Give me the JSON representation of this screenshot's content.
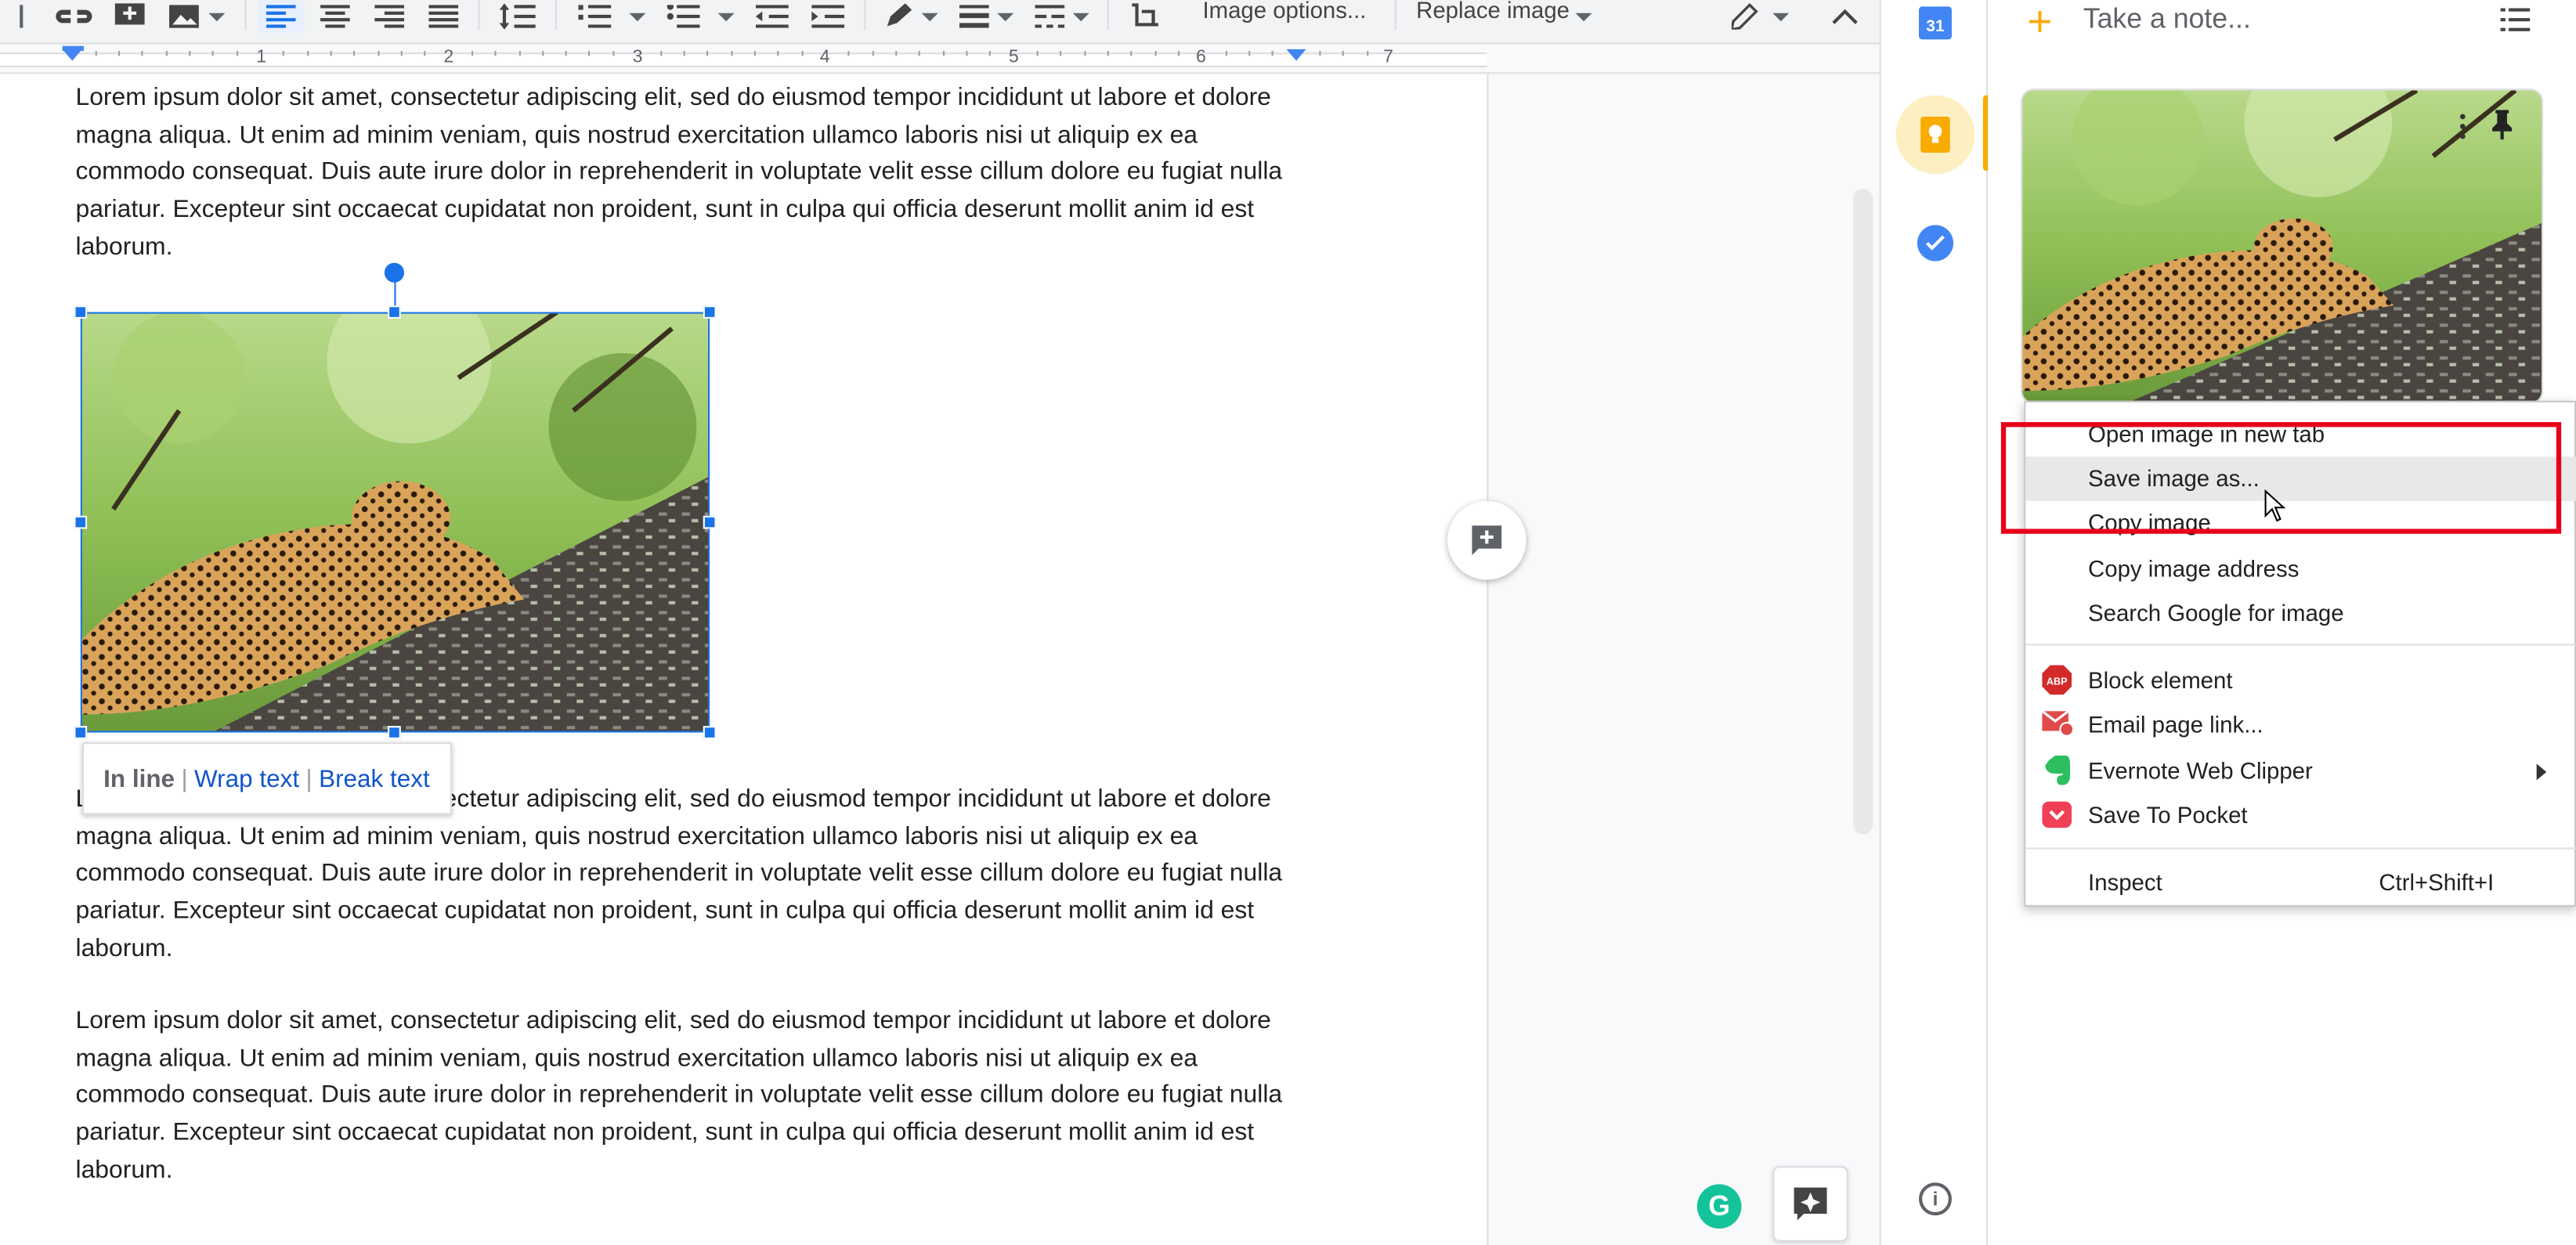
{
  "toolbar": {
    "image_options": "Image options...",
    "replace_image": "Replace image"
  },
  "ruler": {
    "numbers": [
      "1",
      "2",
      "3",
      "4",
      "5",
      "6",
      "7"
    ]
  },
  "document": {
    "paragraph_1": "Lorem ipsum dolor sit amet, consectetur adipiscing elit, sed do eiusmod tempor incididunt ut labore et dolore magna aliqua. Ut enim ad minim veniam, quis nostrud exercitation ullamco laboris nisi ut aliquip ex ea commodo consequat. Duis aute irure dolor in reprehenderit in voluptate velit esse cillum dolore eu fugiat nulla pariatur. Excepteur sint occaecat cupidatat non proident, sunt in culpa qui officia deserunt mollit anim id est laborum.",
    "paragraph_2": "Lorem ipsum dolor sit amet, consectetur adipiscing elit, sed do eiusmod tempor incididunt ut labore et dolore magna aliqua. Ut enim ad minim veniam, quis nostrud exercitation ullamco laboris nisi ut aliquip ex ea commodo consequat. Duis aute irure dolor in reprehenderit in voluptate velit esse cillum dolore eu fugiat nulla pariatur. Excepteur sint occaecat cupidatat non proident, sunt in culpa qui officia deserunt mollit anim id est laborum.",
    "paragraph_3": "Lorem ipsum dolor sit amet, consectetur adipiscing elit, sed do eiusmod tempor incididunt ut labore et dolore magna aliqua. Ut enim ad minim veniam, quis nostrud exercitation ullamco laboris nisi ut aliquip ex ea commodo consequat. Duis aute irure dolor in reprehenderit in voluptate velit esse cillum dolore eu fugiat nulla pariatur. Excepteur sint occaecat cupidatat non proident, sunt in culpa qui officia deserunt mollit anim id est laborum.",
    "wrap_options": {
      "in_line": "In line",
      "separator": "|",
      "wrap_text": "Wrap text",
      "break_text": "Break text"
    }
  },
  "side_strip": {
    "calendar_day": "31"
  },
  "keep": {
    "note_placeholder": "Take a note..."
  },
  "context_menu": {
    "items": [
      {
        "label": "Open image in new tab"
      },
      {
        "label": "Save image as..."
      },
      {
        "label": "Copy image"
      },
      {
        "label": "Copy image address"
      },
      {
        "label": "Search Google for image"
      },
      {
        "label": "Block element"
      },
      {
        "label": "Email page link..."
      },
      {
        "label": "Evernote Web Clipper"
      },
      {
        "label": "Save To Pocket"
      },
      {
        "label": "Inspect",
        "shortcut": "Ctrl+Shift+I"
      }
    ],
    "extension_icons": {
      "abp": "ABP"
    }
  },
  "colors": {
    "selection_blue": "#1a73e8",
    "highlight_red": "#e8001b",
    "keep_yellow": "#f9ab00",
    "grammarly_green": "#15c39a"
  }
}
